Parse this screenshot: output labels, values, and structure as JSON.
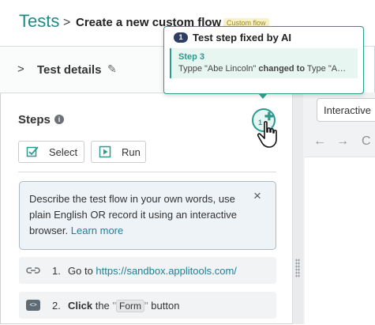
{
  "header": {
    "brand": "Tests",
    "separator": ">",
    "page_title": "Create a new custom flow",
    "badge": "Custom flow"
  },
  "details": {
    "chevron": ">",
    "label": "Test details",
    "edit_icon": "pencil-icon"
  },
  "steps": {
    "title": "Steps",
    "info_icon": "i",
    "ai_fix_count": "1",
    "select_label": "Select",
    "run_label": "Run"
  },
  "hint": {
    "text": "Describe the test flow in your own words, use plain English OR record it using an interactive browser.",
    "link": "Learn more",
    "close": "×"
  },
  "step_list": [
    {
      "num": "1.",
      "prefix": "Go to",
      "link": "https://sandbox.applitools.com/"
    },
    {
      "num": "2.",
      "keyword": "Click",
      "the": "the",
      "open_q": "\"",
      "chip": "Form",
      "close_q": "\"",
      "suffix": "button"
    }
  ],
  "browser": {
    "mode": "Interactive",
    "back": "←",
    "forward": "→",
    "reload": "C"
  },
  "popover": {
    "count": "1",
    "title": "Test step fixed by AI",
    "step_label": "Step 3",
    "change_before": "Typpe \"Abe Lincoln\"",
    "changed_to": "changed to",
    "change_after": "Type \"A…"
  },
  "colors": {
    "brand": "#1f8a85",
    "accent": "#2c9a8d",
    "badge_bg": "#f8f1c6",
    "hint_bg": "#eef3f8",
    "count_badge": "#2f3e63"
  }
}
